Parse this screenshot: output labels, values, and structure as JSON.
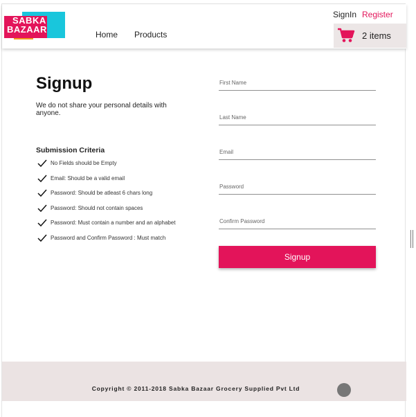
{
  "brand": {
    "logo_line1": "SABKA",
    "logo_line2": "BAZAAR"
  },
  "header": {
    "nav": [
      {
        "label": "Home"
      },
      {
        "label": "Products"
      }
    ],
    "signin_label": "SignIn",
    "register_label": "Register",
    "cart": {
      "icon": "cart-icon",
      "count_label": "2 items"
    }
  },
  "signup": {
    "title": "Signup",
    "subtitle": "We do not share your personal details with anyone.",
    "criteria_title": "Submission Criteria",
    "criteria": [
      "No Fields should be Empty",
      "Email: Should be a valid email",
      "Password: Should be atleast 6 chars long",
      "Password: Should not contain spaces",
      "Password: Must contain a number and an alphabet",
      "Password and Confirm Password : Must match"
    ]
  },
  "form": {
    "first_name_placeholder": "First Name",
    "last_name_placeholder": "Last Name",
    "email_placeholder": "Email",
    "password_placeholder": "Password",
    "confirm_password_placeholder": "Confirm Password",
    "submit_label": "Signup"
  },
  "footer": {
    "copyright": "Copyright © 2011-2018 Sabka Bazaar Grocery Supplied Pvt Ltd"
  },
  "colors": {
    "accent": "#e3145a",
    "cart_bg": "#ece6e6",
    "footer_bg": "#ebe3e3"
  }
}
